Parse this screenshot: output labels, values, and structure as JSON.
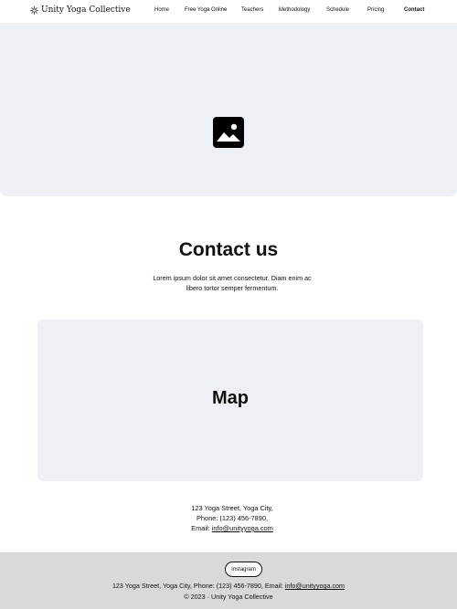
{
  "header": {
    "brand_name": "Unity Yoga Collective",
    "nav": [
      {
        "label": "Home"
      },
      {
        "label": "Free Yoga Online"
      },
      {
        "label": "Teachers"
      },
      {
        "label": "Methodology"
      },
      {
        "label": "Schedule"
      },
      {
        "label": "Pricing"
      },
      {
        "label": "Contact",
        "active": true
      }
    ]
  },
  "hero": {
    "icon": "image-placeholder-icon"
  },
  "contact": {
    "title": "Contact us",
    "description": "Lorem ipsum dolor sit amet consectetur. Diam enim ac libero tortor semper fermentum."
  },
  "map": {
    "label": "Map"
  },
  "address": {
    "line1": "123 Yoga Street, Yoga City,",
    "line2": "Phone: (123) 456-7890,",
    "email_prefix": "Email: ",
    "email": "info@unityyoga.com"
  },
  "footer": {
    "instagram_label": "Instagram",
    "info_prefix": "123 Yoga Street, Yoga City, Phone: (123) 456-7890, Email: ",
    "email": "info@unityyoga.com",
    "copyright": "© 2023 · Unity Yoga Collective"
  },
  "colors": {
    "placeholder_bg": "#edf0f5",
    "footer_bg": "#d9d9d9",
    "text": "#111111"
  }
}
